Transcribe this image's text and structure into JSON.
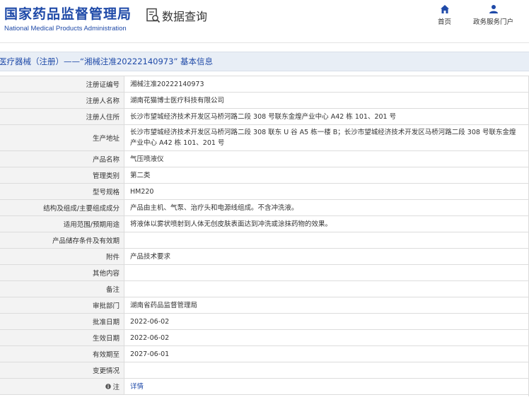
{
  "header": {
    "brand_cn": "国家药品监督管理局",
    "brand_en": "National Medical Products Administration",
    "query_label": "数据查询",
    "nav": [
      {
        "label": "首页",
        "icon": "home-icon"
      },
      {
        "label": "政务服务门户",
        "icon": "user-icon"
      }
    ]
  },
  "title": "医疗器械（注册）——“湘械注准20222140973” 基本信息",
  "rows": [
    {
      "label": "注册证编号",
      "value": "湘械注准20222140973"
    },
    {
      "label": "注册人名称",
      "value": "湖南花猫博士医疗科技有限公司"
    },
    {
      "label": "注册人住所",
      "value": "长沙市望城经济技术开发区马桥河路二段 308 号联东金煌产业中心 A42 栋 101、201 号"
    },
    {
      "label": "生产地址",
      "value": "长沙市望城经济技术开发区马桥河路二段 308 联东 U 谷 A5 栋一楼 B；长沙市望城经济技术开发区马桥河路二段 308 号联东金煌产业中心 A42 栋 101、201 号"
    },
    {
      "label": "产品名称",
      "value": "气压喷液仪"
    },
    {
      "label": "管理类别",
      "value": "第二类"
    },
    {
      "label": "型号规格",
      "value": "HM220"
    },
    {
      "label": "结构及组成/主要组成成分",
      "value": "产品由主机、气泵、治疗头和电源线组成。不含冲洗液。"
    },
    {
      "label": "适用范围/预期用途",
      "value": "将液体以雾状喷射到人体无创皮肤表面达到冲洗或涂抹药物的效果。"
    },
    {
      "label": "产品储存条件及有效期",
      "value": ""
    },
    {
      "label": "附件",
      "value": "产品技术要求"
    },
    {
      "label": "其他内容",
      "value": ""
    },
    {
      "label": "备注",
      "value": ""
    },
    {
      "label": "审批部门",
      "value": "湖南省药品监督管理局"
    },
    {
      "label": "批准日期",
      "value": "2022-06-02"
    },
    {
      "label": "生效日期",
      "value": "2022-06-02"
    },
    {
      "label": "有效期至",
      "value": "2027-06-01"
    },
    {
      "label": "变更情况",
      "value": ""
    },
    {
      "label": "注",
      "value": "详情"
    }
  ],
  "colors": {
    "brand": "#1f4aa8",
    "label_bg": "#f3f3f3",
    "title_bg": "#e8eef6",
    "border": "#dcdcdc"
  }
}
